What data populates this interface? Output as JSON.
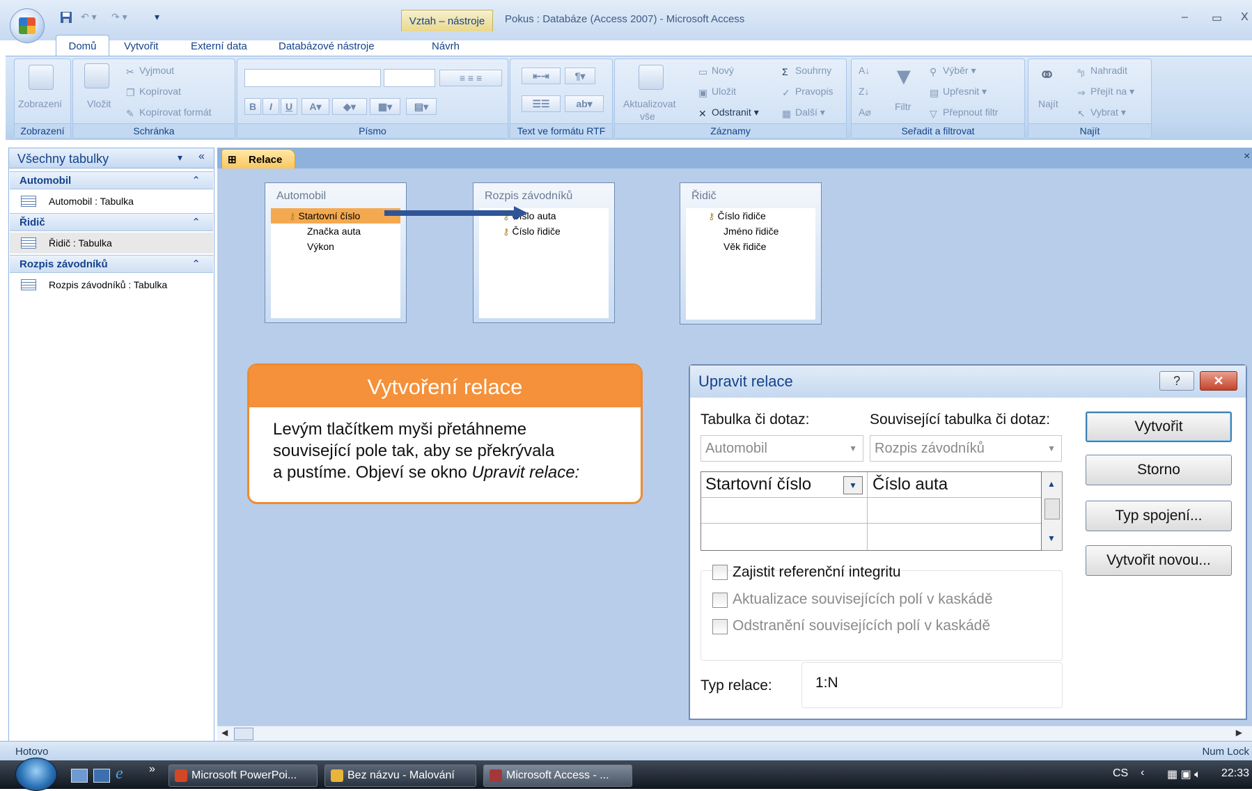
{
  "window": {
    "context_tab": "Vztah – nástroje",
    "title": "Pokus : Databáze (Access 2007) - Microsoft Access",
    "minimize": "–",
    "restore": "▭",
    "close": "X"
  },
  "tabs": [
    "Domů",
    "Vytvořit",
    "Externí data",
    "Databázové nástroje",
    "Návrh"
  ],
  "ribbon": {
    "groups": {
      "zobrazeni": "Zobrazení",
      "schranka": "Schránka",
      "pismo": "Písmo",
      "rtf": "Text ve formátu RTF",
      "zaznamy": "Záznamy",
      "seradit": "Seřadit a filtrovat",
      "najit": "Najít"
    },
    "zobrazeni_btn": "Zobrazení",
    "vlozit_btn": "Vložit",
    "vyjmout": "Vyjmout",
    "kopirovat": "Kopírovat",
    "kopirovat_format": "Kopírovat formát",
    "aktualizovat": "Aktualizovat",
    "vse": "vše",
    "novy": "Nový",
    "ulozit": "Uložit",
    "odstranit": "Odstranit",
    "souhrny": "Souhrny",
    "pravopis": "Pravopis",
    "dalsi": "Další",
    "filtr": "Filtr",
    "vyber": "Výběr",
    "upresnit": "Upřesnit",
    "prepnout_filtr": "Přepnout filtr",
    "najit_btn": "Najít",
    "nahradit": "Nahradit",
    "prejit_na": "Přejít na",
    "vybrat": "Vybrat"
  },
  "nav": {
    "header": "Všechny tabulky",
    "groups": [
      {
        "title": "Automobil",
        "item": "Automobil : Tabulka"
      },
      {
        "title": "Řidič",
        "item": "Řidič : Tabulka"
      },
      {
        "title": "Rozpis závodníků",
        "item": "Rozpis závodníků : Tabulka"
      }
    ]
  },
  "doc_tab": "Relace",
  "tables": {
    "automobil": {
      "title": "Automobil",
      "fields": [
        "Startovní číslo",
        "Značka auta",
        "Výkon"
      ]
    },
    "rozpis": {
      "title": "Rozpis závodníků",
      "fields": [
        "Číslo auta",
        "Číslo řidiče"
      ]
    },
    "ridic": {
      "title": "Řidič",
      "fields": [
        "Číslo řidiče",
        "Jméno řidiče",
        "Věk řidiče"
      ]
    }
  },
  "callout": {
    "title": "Vytvoření relace",
    "body_line1": "Levým tlačítkem myši přetáhneme",
    "body_line2": "související pole tak, aby se překrývala",
    "body_line3": "a pustíme. Objeví se okno ",
    "body_italic": "Upravit relace:"
  },
  "dialog": {
    "title": "Upravit relace",
    "help": "?",
    "table_label": "Tabulka či dotaz:",
    "related_label": "Související tabulka či dotaz:",
    "table_value": "Automobil",
    "related_value": "Rozpis závodníků",
    "field_left": "Startovní číslo",
    "field_right": "Číslo auta",
    "chk_integrity": "Zajistit referenční integritu",
    "chk_update": "Aktualizace souvisejících polí v kaskádě",
    "chk_delete": "Odstranění souvisejících polí v kaskádě",
    "rel_type_label": "Typ relace:",
    "rel_type_value": "1:N",
    "btn_create": "Vytvořit",
    "btn_cancel": "Storno",
    "btn_join": "Typ spojení...",
    "btn_new": "Vytvořit novou..."
  },
  "status": {
    "left": "Hotovo",
    "right": "Num Lock"
  },
  "taskbar": {
    "items": [
      "Microsoft PowerPoi...",
      "Bez názvu - Malování",
      "Microsoft Access - ..."
    ],
    "lang": "CS",
    "time": "22:33"
  }
}
